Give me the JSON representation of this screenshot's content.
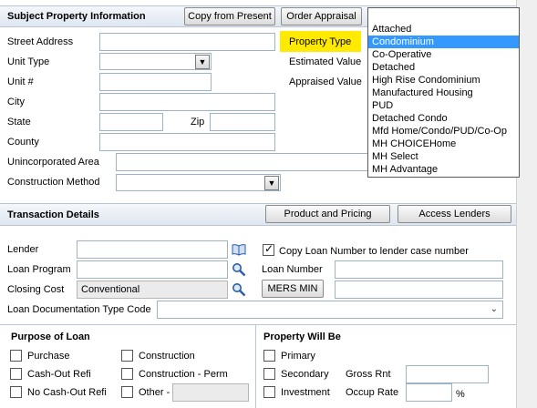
{
  "subject_property": {
    "title": "Subject Property Information",
    "copy_button": "Copy from Present",
    "order_button": "Order Appraisal",
    "labels": {
      "street_address": "Street Address",
      "unit_type": "Unit Type",
      "unit_num": "Unit #",
      "city": "City",
      "state": "State",
      "zip": "Zip",
      "county": "County",
      "unincorporated": "Unincorporated Area",
      "construction_method": "Construction Method",
      "property_type": "Property Type",
      "estimated_value": "Estimated Value",
      "appraised_value": "Appraised Value"
    },
    "property_type_options": [
      "Attached",
      "Condominium",
      "Co-Operative",
      "Detached",
      "High Rise Condominium",
      "Manufactured Housing",
      "PUD",
      "Detached Condo",
      "Mfd Home/Condo/PUD/Co-Op",
      "MH CHOICEHome",
      "MH Select",
      "MH Advantage"
    ],
    "property_type_highlighted": "Condominium"
  },
  "transaction": {
    "title": "Transaction Details",
    "product_button": "Product and Pricing",
    "access_button": "Access Lenders",
    "labels": {
      "lender": "Lender",
      "copy_loan": "Copy Loan Number to lender case number",
      "loan_program": "Loan Program",
      "loan_number": "Loan Number",
      "closing_cost": "Closing Cost",
      "mers_min": "MERS MIN",
      "loan_doc_type": "Loan Documentation Type Code"
    },
    "closing_cost_value": "Conventional",
    "copy_loan_checked": true
  },
  "purpose": {
    "title": "Purpose of Loan",
    "items": {
      "purchase": "Purchase",
      "cashout": "Cash-Out Refi",
      "nocashout": "No Cash-Out Refi",
      "construction": "Construction",
      "construction_perm": "Construction - Perm",
      "other": "Other -"
    }
  },
  "property_will_be": {
    "title": "Property Will Be",
    "items": {
      "primary": "Primary",
      "secondary": "Secondary",
      "investment": "Investment"
    },
    "gross_rent": "Gross Rnt",
    "occup_rate": "Occup Rate",
    "percent": "%"
  },
  "colors": {
    "section_header": "#dfe6f0",
    "property_type_highlight": "#ffea00",
    "dropdown_selection": "#3399ff",
    "field_border": "#9eb2c8"
  }
}
